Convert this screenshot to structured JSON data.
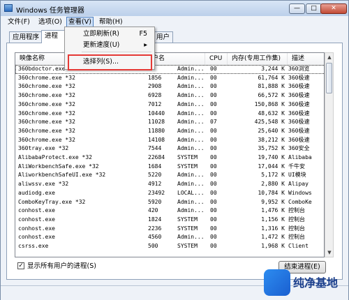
{
  "window": {
    "title": "Windows 任务管理器"
  },
  "menu": {
    "items": [
      "文件(F)",
      "选项(O)",
      "查看(V)",
      "帮助(H)"
    ]
  },
  "tabs": [
    "应用程序",
    "进程",
    "用户"
  ],
  "dropdown": {
    "items": [
      {
        "label": "立即刷新(R)",
        "shortcut": "F5"
      },
      {
        "label": "更新速度(U)",
        "shortcut": "▸"
      },
      {
        "label": "选择列(S)...",
        "shortcut": ""
      }
    ]
  },
  "columns": [
    "映像名称",
    "户名",
    "CPU",
    "内存(专用工作集)",
    "描述"
  ],
  "processes": [
    [
      "360bdoctor.exe",
      "",
      "Admin...",
      "00",
      "3,244 K",
      "360浏览"
    ],
    [
      "360chrome.exe *32",
      "1856",
      "Admin...",
      "00",
      "61,764 K",
      "360极速"
    ],
    [
      "360chrome.exe *32",
      "2908",
      "Admin...",
      "00",
      "81,888 K",
      "360极速"
    ],
    [
      "360chrome.exe *32",
      "6928",
      "Admin...",
      "00",
      "66,572 K",
      "360极速"
    ],
    [
      "360chrome.exe *32",
      "7012",
      "Admin...",
      "00",
      "150,868 K",
      "360极速"
    ],
    [
      "360chrome.exe *32",
      "10440",
      "Admin...",
      "00",
      "48,632 K",
      "360极速"
    ],
    [
      "360chrome.exe *32",
      "11028",
      "Admin...",
      "07",
      "425,548 K",
      "360极速"
    ],
    [
      "360chrome.exe *32",
      "11880",
      "Admin...",
      "00",
      "25,640 K",
      "360极速"
    ],
    [
      "360chrome.exe *32",
      "14108",
      "Admin...",
      "00",
      "38,212 K",
      "360极速"
    ],
    [
      "360tray.exe *32",
      "7544",
      "Admin...",
      "00",
      "35,752 K",
      "360安全"
    ],
    [
      "AlibabaProtect.exe *32",
      "22684",
      "SYSTEM",
      "00",
      "19,740 K",
      "Alibaba"
    ],
    [
      "AliWorkbenchSafe.exe *32",
      "1684",
      "SYSTEM",
      "00",
      "17,044 K",
      "千牛安"
    ],
    [
      "AliworkbenchSafeUI.exe *32",
      "5220",
      "Admin...",
      "00",
      "5,172 K",
      "UI模块"
    ],
    [
      "aliwssv.exe *32",
      "4912",
      "Admin...",
      "00",
      "2,880 K",
      "Alipay"
    ],
    [
      "audiodg.exe",
      "23492",
      "LOCAL...",
      "00",
      "10,784 K",
      "Windows"
    ],
    [
      "ComboKeyTray.exe *32",
      "5920",
      "Admin...",
      "00",
      "9,952 K",
      "ComboKe"
    ],
    [
      "conhost.exe",
      "420",
      "Admin...",
      "00",
      "1,476 K",
      "控制台"
    ],
    [
      "conhost.exe",
      "1824",
      "SYSTEM",
      "00",
      "1,156 K",
      "控制台"
    ],
    [
      "conhost.exe",
      "2236",
      "SYSTEM",
      "00",
      "1,316 K",
      "控制台"
    ],
    [
      "conhost.exe",
      "4560",
      "Admin...",
      "00",
      "1,472 K",
      "控制台"
    ],
    [
      "csrss.exe",
      "500",
      "SYSTEM",
      "00",
      "1,968 K",
      "Client"
    ]
  ],
  "footer": {
    "show_all_label": "显示所有用户的进程(S)",
    "show_all_checked": "✓",
    "end_process_label": "结束进程(E)"
  },
  "watermark": {
    "text": "纯净基地"
  }
}
